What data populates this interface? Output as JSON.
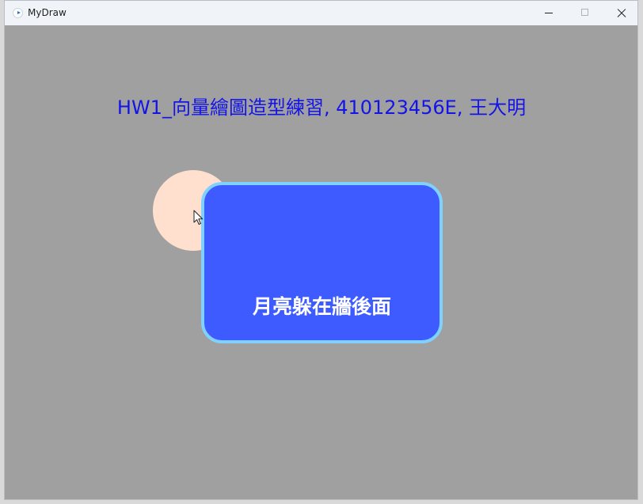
{
  "window": {
    "title": "MyDraw",
    "icon": "app-icon",
    "controls": [
      "minimize-icon",
      "maximize-icon",
      "close-icon"
    ]
  },
  "canvas": {
    "background": "#a0a0a0",
    "heading": "HW1_向量繪圖造型練習, 410123456E, 王大明",
    "heading_color": "#1414e6",
    "moon_color": "#ffdfcd",
    "wall": {
      "label": "月亮躲在牆後面",
      "fill": "#3d5bfe",
      "border": "#7fd2ff",
      "text_color": "#ffffff"
    }
  }
}
